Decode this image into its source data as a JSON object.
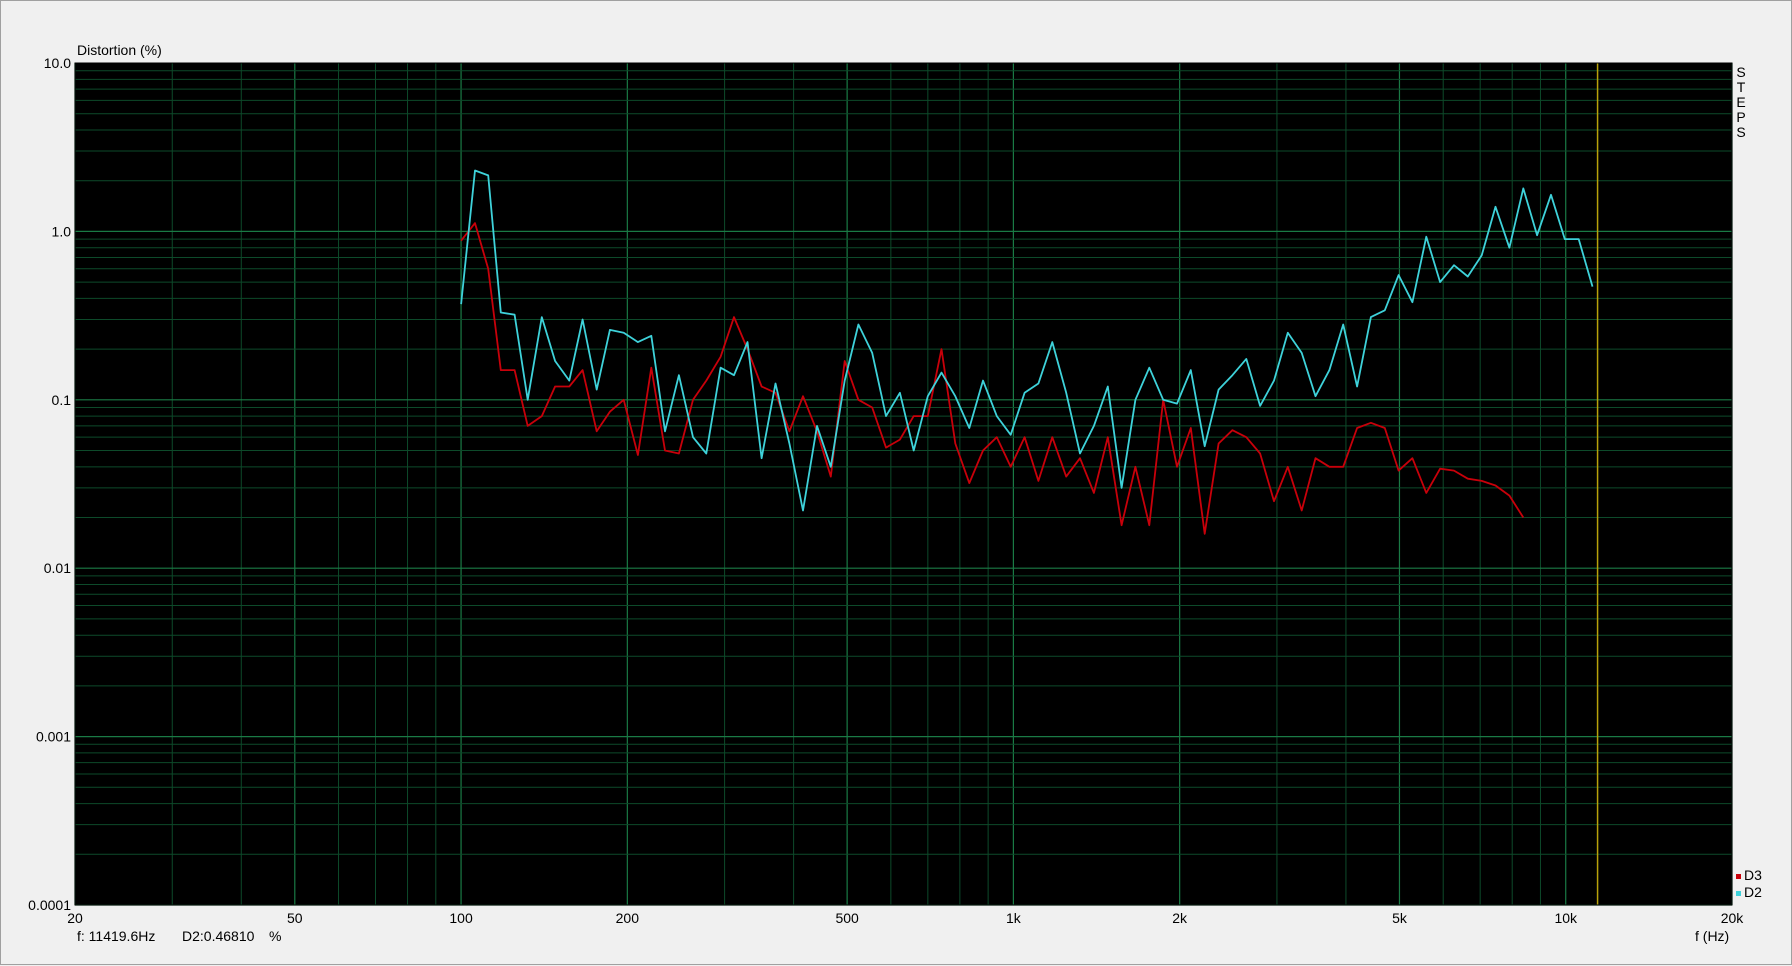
{
  "chart_data": {
    "type": "line",
    "ylabel": "Distortion (%)",
    "xlabel": "f (Hz)",
    "x_scale": "log",
    "y_scale": "log",
    "xlim": [
      20,
      20000
    ],
    "ylim": [
      0.0001,
      10
    ],
    "x_ticks": [
      {
        "value": 20,
        "label": "20"
      },
      {
        "value": 50,
        "label": "50"
      },
      {
        "value": 100,
        "label": "100"
      },
      {
        "value": 200,
        "label": "200"
      },
      {
        "value": 500,
        "label": "500"
      },
      {
        "value": 1000,
        "label": "1k"
      },
      {
        "value": 2000,
        "label": "2k"
      },
      {
        "value": 5000,
        "label": "5k"
      },
      {
        "value": 10000,
        "label": "10k"
      },
      {
        "value": 20000,
        "label": "20k"
      }
    ],
    "y_ticks": [
      {
        "value": 10,
        "label": "10.0"
      },
      {
        "value": 1,
        "label": "1.0"
      },
      {
        "value": 0.1,
        "label": "0.1"
      },
      {
        "value": 0.01,
        "label": "0.01"
      },
      {
        "value": 0.001,
        "label": "0.001"
      },
      {
        "value": 0.0001,
        "label": "0.0001"
      }
    ],
    "grid": true,
    "legend_position": "bottom-right",
    "side_label": "STEPS",
    "cursor": {
      "frequency": 11419.6,
      "readout_frequency": "f: 11419.6Hz",
      "readout_value": "D2:0.46810",
      "readout_unit": "%"
    },
    "series": [
      {
        "name": "D3",
        "color": "#c8000a",
        "points": [
          [
            100,
            0.88
          ],
          [
            106,
            1.12
          ],
          [
            112,
            0.6
          ],
          [
            118,
            0.15
          ],
          [
            125,
            0.15
          ],
          [
            132,
            0.07
          ],
          [
            140,
            0.08
          ],
          [
            148,
            0.12
          ],
          [
            157,
            0.12
          ],
          [
            166,
            0.15
          ],
          [
            176,
            0.065
          ],
          [
            186,
            0.085
          ],
          [
            197,
            0.1
          ],
          [
            209,
            0.047
          ],
          [
            221,
            0.155
          ],
          [
            234,
            0.05
          ],
          [
            248,
            0.048
          ],
          [
            263,
            0.1
          ],
          [
            278,
            0.13
          ],
          [
            295,
            0.18
          ],
          [
            312,
            0.31
          ],
          [
            330,
            0.2
          ],
          [
            350,
            0.12
          ],
          [
            371,
            0.11
          ],
          [
            393,
            0.065
          ],
          [
            416,
            0.105
          ],
          [
            441,
            0.065
          ],
          [
            467,
            0.035
          ],
          [
            495,
            0.17
          ],
          [
            524,
            0.1
          ],
          [
            555,
            0.09
          ],
          [
            588,
            0.052
          ],
          [
            623,
            0.058
          ],
          [
            660,
            0.08
          ],
          [
            700,
            0.08
          ],
          [
            741,
            0.2
          ],
          [
            785,
            0.055
          ],
          [
            832,
            0.032
          ],
          [
            881,
            0.05
          ],
          [
            933,
            0.06
          ],
          [
            989,
            0.04
          ],
          [
            1048,
            0.06
          ],
          [
            1110,
            0.033
          ],
          [
            1176,
            0.06
          ],
          [
            1246,
            0.035
          ],
          [
            1320,
            0.045
          ],
          [
            1399,
            0.028
          ],
          [
            1482,
            0.06
          ],
          [
            1570,
            0.018
          ],
          [
            1663,
            0.04
          ],
          [
            1762,
            0.018
          ],
          [
            1867,
            0.1
          ],
          [
            1978,
            0.04
          ],
          [
            2095,
            0.068
          ],
          [
            2220,
            0.016
          ],
          [
            2352,
            0.055
          ],
          [
            2492,
            0.066
          ],
          [
            2640,
            0.06
          ],
          [
            2797,
            0.048
          ],
          [
            2963,
            0.025
          ],
          [
            3139,
            0.04
          ],
          [
            3326,
            0.022
          ],
          [
            3523,
            0.045
          ],
          [
            3733,
            0.04
          ],
          [
            3955,
            0.04
          ],
          [
            4190,
            0.068
          ],
          [
            4439,
            0.073
          ],
          [
            4703,
            0.068
          ],
          [
            4982,
            0.038
          ],
          [
            5278,
            0.045
          ],
          [
            5592,
            0.028
          ],
          [
            5924,
            0.039
          ],
          [
            6276,
            0.038
          ],
          [
            6649,
            0.034
          ],
          [
            7044,
            0.033
          ],
          [
            7463,
            0.031
          ],
          [
            7907,
            0.027
          ],
          [
            8377,
            0.02
          ]
        ]
      },
      {
        "name": "D2",
        "color": "#3ed2da",
        "points": [
          [
            100,
            0.37
          ],
          [
            106,
            2.3
          ],
          [
            112,
            2.15
          ],
          [
            118,
            0.33
          ],
          [
            125,
            0.32
          ],
          [
            132,
            0.1
          ],
          [
            140,
            0.31
          ],
          [
            148,
            0.17
          ],
          [
            157,
            0.13
          ],
          [
            166,
            0.3
          ],
          [
            176,
            0.115
          ],
          [
            186,
            0.26
          ],
          [
            197,
            0.25
          ],
          [
            209,
            0.22
          ],
          [
            221,
            0.24
          ],
          [
            234,
            0.065
          ],
          [
            248,
            0.14
          ],
          [
            263,
            0.06
          ],
          [
            278,
            0.048
          ],
          [
            295,
            0.155
          ],
          [
            312,
            0.14
          ],
          [
            330,
            0.22
          ],
          [
            350,
            0.045
          ],
          [
            371,
            0.125
          ],
          [
            393,
            0.055
          ],
          [
            416,
            0.022
          ],
          [
            441,
            0.07
          ],
          [
            467,
            0.04
          ],
          [
            495,
            0.13
          ],
          [
            524,
            0.28
          ],
          [
            555,
            0.19
          ],
          [
            588,
            0.08
          ],
          [
            623,
            0.11
          ],
          [
            660,
            0.05
          ],
          [
            700,
            0.105
          ],
          [
            741,
            0.145
          ],
          [
            785,
            0.105
          ],
          [
            832,
            0.068
          ],
          [
            881,
            0.13
          ],
          [
            933,
            0.08
          ],
          [
            989,
            0.062
          ],
          [
            1048,
            0.11
          ],
          [
            1110,
            0.125
          ],
          [
            1176,
            0.22
          ],
          [
            1246,
            0.11
          ],
          [
            1320,
            0.048
          ],
          [
            1399,
            0.07
          ],
          [
            1482,
            0.12
          ],
          [
            1570,
            0.03
          ],
          [
            1663,
            0.1
          ],
          [
            1762,
            0.155
          ],
          [
            1867,
            0.1
          ],
          [
            1978,
            0.095
          ],
          [
            2095,
            0.15
          ],
          [
            2220,
            0.053
          ],
          [
            2352,
            0.115
          ],
          [
            2492,
            0.14
          ],
          [
            2640,
            0.175
          ],
          [
            2797,
            0.092
          ],
          [
            2963,
            0.13
          ],
          [
            3139,
            0.25
          ],
          [
            3326,
            0.19
          ],
          [
            3523,
            0.105
          ],
          [
            3733,
            0.15
          ],
          [
            3955,
            0.28
          ],
          [
            4190,
            0.12
          ],
          [
            4439,
            0.31
          ],
          [
            4703,
            0.34
          ],
          [
            4982,
            0.55
          ],
          [
            5278,
            0.38
          ],
          [
            5592,
            0.93
          ],
          [
            5924,
            0.5
          ],
          [
            6276,
            0.63
          ],
          [
            6649,
            0.54
          ],
          [
            7044,
            0.72
          ],
          [
            7463,
            1.4
          ],
          [
            7907,
            0.8
          ],
          [
            8377,
            1.8
          ],
          [
            8875,
            0.95
          ],
          [
            9403,
            1.65
          ],
          [
            9962,
            0.9
          ],
          [
            10554,
            0.9
          ],
          [
            11181,
            0.47
          ]
        ]
      }
    ]
  }
}
